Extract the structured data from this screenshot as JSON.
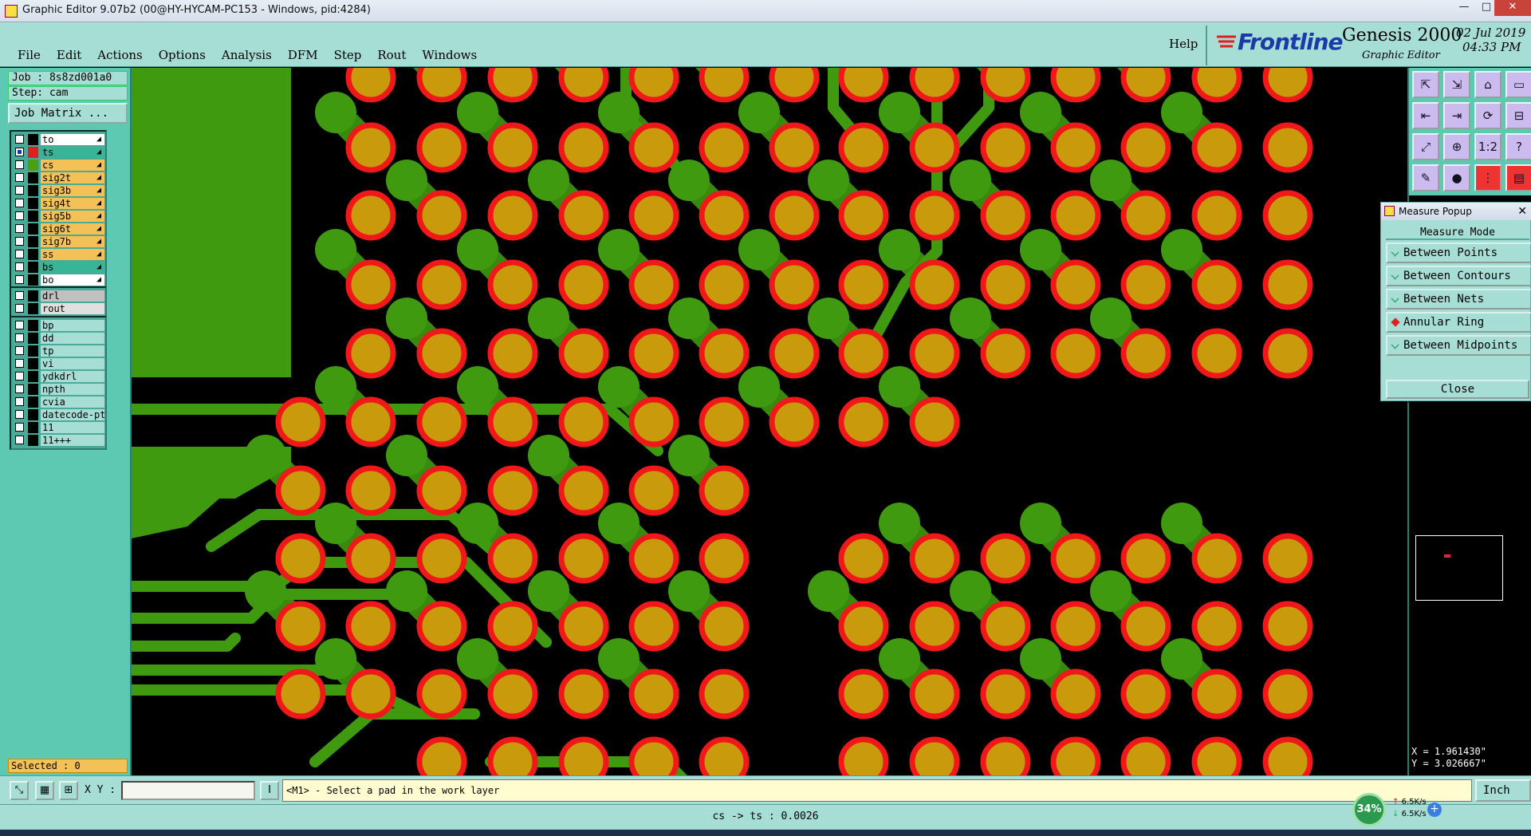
{
  "window": {
    "title": "Graphic Editor 9.07b2 (00@HY-HYCAM-PC153 - Windows, pid:4284)",
    "minimize": "—",
    "maximize": "□",
    "close": "✕"
  },
  "menu": {
    "items": [
      "File",
      "Edit",
      "Actions",
      "Options",
      "Analysis",
      "DFM",
      "Step",
      "Rout",
      "Windows"
    ],
    "help": "Help"
  },
  "brand": {
    "logo": "Frontline",
    "product": "Genesis 2000",
    "subtitle": "Graphic Editor",
    "date": "02 Jul 2019",
    "time": "04:33 PM"
  },
  "job": {
    "job_line": "Job : 8s8zd001a0",
    "step_line": "Step: cam",
    "matrix_button": "Job Matrix ..."
  },
  "layers": {
    "board": [
      {
        "name": "to",
        "swatch": "#000000",
        "bg": "#ffffff",
        "checked": false
      },
      {
        "name": "ts",
        "swatch": "#e02020",
        "bg": "#38b596",
        "checked": true
      },
      {
        "name": "cs",
        "swatch": "#4aa012",
        "bg": "#f3c155",
        "checked": false
      },
      {
        "name": "sig2t",
        "swatch": "#000000",
        "bg": "#f3c155",
        "checked": false
      },
      {
        "name": "sig3b",
        "swatch": "#000000",
        "bg": "#f3c155",
        "checked": false
      },
      {
        "name": "sig4t",
        "swatch": "#000000",
        "bg": "#f3c155",
        "checked": false
      },
      {
        "name": "sig5b",
        "swatch": "#000000",
        "bg": "#f3c155",
        "checked": false
      },
      {
        "name": "sig6t",
        "swatch": "#000000",
        "bg": "#f3c155",
        "checked": false
      },
      {
        "name": "sig7b",
        "swatch": "#000000",
        "bg": "#f3c155",
        "checked": false
      },
      {
        "name": "ss",
        "swatch": "#000000",
        "bg": "#f3c155",
        "checked": false
      },
      {
        "name": "bs",
        "swatch": "#000000",
        "bg": "#38b596",
        "checked": false
      },
      {
        "name": "bo",
        "swatch": "#000000",
        "bg": "#ffffff",
        "checked": false
      }
    ],
    "drill": [
      {
        "name": "drl",
        "swatch": "#000000",
        "bg": "#c0c0c0",
        "checked": false
      },
      {
        "name": "rout",
        "swatch": "#000000",
        "bg": "#e0e0e0",
        "checked": false
      }
    ],
    "misc": [
      {
        "name": "bp",
        "swatch": "#000000",
        "bg": "#a6ded6",
        "checked": false
      },
      {
        "name": "dd",
        "swatch": "#000000",
        "bg": "#a6ded6",
        "checked": false
      },
      {
        "name": "tp",
        "swatch": "#000000",
        "bg": "#a6ded6",
        "checked": false
      },
      {
        "name": "vi",
        "swatch": "#000000",
        "bg": "#a6ded6",
        "checked": false
      },
      {
        "name": "ydkdrl",
        "swatch": "#000000",
        "bg": "#a6ded6",
        "checked": false
      },
      {
        "name": "npth",
        "swatch": "#000000",
        "bg": "#a6ded6",
        "checked": false
      },
      {
        "name": "cvia",
        "swatch": "#000000",
        "bg": "#a6ded6",
        "checked": false
      },
      {
        "name": "datecode-ptc",
        "swatch": "#000000",
        "bg": "#a6ded6",
        "checked": false
      },
      {
        "name": "11",
        "swatch": "#000000",
        "bg": "#a6ded6",
        "checked": false
      },
      {
        "name": "11+++",
        "swatch": "#000000",
        "bg": "#a6ded6",
        "checked": false
      }
    ],
    "selected_text": "Selected : 0"
  },
  "measure_popup": {
    "title": "Measure Popup",
    "mode_header": "Measure Mode",
    "options": [
      "Between Points",
      "Between Contours",
      "Between Nets",
      "Annular Ring",
      "Between Midpoints"
    ],
    "active_option": "Annular Ring",
    "close_label": "Close"
  },
  "coords": {
    "x": "X = 1.961430\"",
    "y": "Y = 3.026667\""
  },
  "bottom": {
    "xy_label": "X Y :",
    "xy_value": "",
    "prompt": "<M1> - Select a pad in the work layer",
    "units": "Inch",
    "status": "cs -> ts : 0.0026"
  },
  "net_widget": {
    "percent": "34%",
    "up_rate": "6.5K/s",
    "down_rate": "6.5K/s"
  },
  "colors": {
    "pad_ring": "#f01818",
    "pad_fill": "#c99a0c",
    "copper": "#3f9a10",
    "background": "#000000",
    "panel": "#5dc9b2",
    "panel_light": "#a6ded6"
  },
  "icons": {
    "tools": [
      "zoom-home-icon",
      "zoom-in-icon",
      "zoom-out-icon",
      "window-icon",
      "pan-left-icon",
      "pan-right-icon",
      "redraw-icon",
      "snap-icon",
      "fit-icon",
      "center-icon",
      "scale-1-2-icon",
      "help-icon",
      "measure-icon",
      "cursor-icon",
      "net-icon",
      "layer-icon"
    ]
  }
}
